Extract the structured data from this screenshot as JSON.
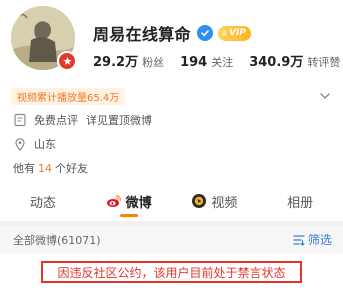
{
  "profile": {
    "name": "周易在线算命",
    "vip_label": "VIP",
    "stats": [
      {
        "value": "29.2万",
        "label": "粉丝"
      },
      {
        "value": "194",
        "label": "关注"
      },
      {
        "value": "340.9万",
        "label": "转评赞"
      }
    ],
    "play_count_tag": "视频累计播放量65.4万",
    "free_rating": "免费点评",
    "pinned_link": "详见置顶微博",
    "location": "山东",
    "friends_prefix": "他有",
    "friends_count": "14",
    "friends_suffix": "个好友"
  },
  "tabs": [
    {
      "label": "动态",
      "icon": "none"
    },
    {
      "label": "微博",
      "icon": "weibo-icon",
      "active": true
    },
    {
      "label": "视频",
      "icon": "video-icon"
    },
    {
      "label": "相册",
      "icon": "none"
    }
  ],
  "feed": {
    "all_posts": "全部微博(61071)",
    "filter_label": "筛选"
  },
  "notice": "因违反社区公约，该用户目前处于禁言状态",
  "colors": {
    "accent_orange": "#ff8200",
    "notice_red": "#e3352d",
    "link_blue": "#3a7bd5"
  }
}
